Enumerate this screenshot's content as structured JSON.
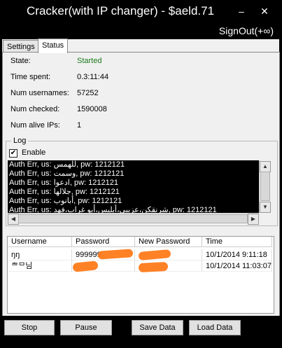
{
  "window": {
    "title": "Cracker(with IP changer) - $aeld.71"
  },
  "menu": {
    "signout_label": "SignOut(+∞)"
  },
  "tabs": [
    {
      "label": "Settings"
    },
    {
      "label": "Status"
    }
  ],
  "status": {
    "state_label": "State:",
    "state_value": "Started",
    "time_label": "Time spent:",
    "time_value": "0.3:11:44",
    "usernames_label": "Num usernames:",
    "usernames_value": "57252",
    "checked_label": "Num checked:",
    "checked_value": "1590008",
    "alive_label": "Num alive IPs:",
    "alive_value": "1",
    "state_color": "#1a7a1a"
  },
  "log": {
    "group_title": "Log",
    "enable_label": "Enable",
    "enabled": true,
    "lines": [
      "Auth Err, us: للهمس, pw: 1212121",
      "Auth Err, us: وسمت, pw: 1212121",
      "Auth Err, us: ادعوا, pw: 1212121",
      "Auth Err, us: جلالها, pw: 1212121",
      "Auth Err, us: أبانوب, pw: 1212121",
      "Auth Err, us: شرنقكن،عزيبي،أبليس،أبو غراب،فهد, pw: 1212121"
    ]
  },
  "results": {
    "columns": [
      "Username",
      "Password",
      "New Password",
      "Time"
    ],
    "rows": [
      {
        "username": "ŋŋ",
        "password": "999999",
        "new_password": "",
        "time": "10/1/2014 9:11:18"
      },
      {
        "username": "ᄅᄇᄆ님",
        "password": "",
        "new_password": "",
        "time": "10/1/2014 11:03:07"
      }
    ],
    "redaction_color": "#ff7a1a"
  },
  "buttons": {
    "stop": "Stop",
    "pause": "Pause",
    "save": "Save Data",
    "load": "Load Data"
  }
}
